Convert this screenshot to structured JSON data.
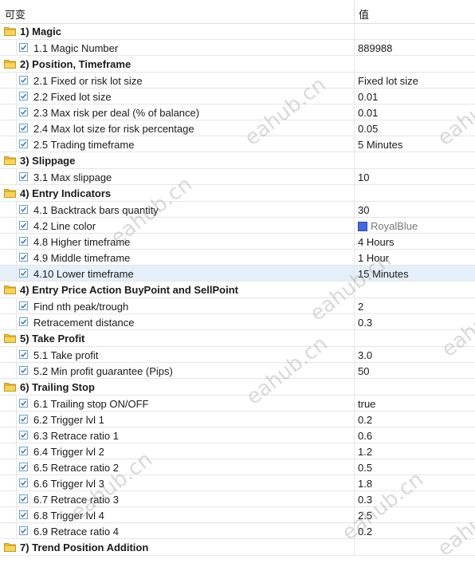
{
  "header": {
    "col_variable": "可变",
    "col_value": "值"
  },
  "rows": [
    {
      "type": "group",
      "label": "1) Magic"
    },
    {
      "type": "item",
      "label": "1.1 Magic Number",
      "value": "889988"
    },
    {
      "type": "group",
      "label": "2) Position, Timeframe"
    },
    {
      "type": "item",
      "label": "2.1 Fixed or risk lot size",
      "value": "Fixed lot size"
    },
    {
      "type": "item",
      "label": "2.2 Fixed lot size",
      "value": "0.01"
    },
    {
      "type": "item",
      "label": "2.3 Max risk per deal (% of balance)",
      "value": "0.01"
    },
    {
      "type": "item",
      "label": "2.4 Max lot size for risk percentage",
      "value": "0.05"
    },
    {
      "type": "item",
      "label": "2.5 Trading timeframe",
      "value": "5 Minutes"
    },
    {
      "type": "group",
      "label": "3) Slippage"
    },
    {
      "type": "item",
      "label": "3.1 Max slippage",
      "value": "10"
    },
    {
      "type": "group",
      "label": "4) Entry Indicators"
    },
    {
      "type": "item",
      "label": "4.1 Backtrack bars quantity",
      "value": "30"
    },
    {
      "type": "item",
      "label": "4.2 Line color",
      "value": "RoyalBlue",
      "color": "#4169E1"
    },
    {
      "type": "item",
      "label": "4.8 Higher timeframe",
      "value": "4 Hours"
    },
    {
      "type": "item",
      "label": "4.9 Middle timeframe",
      "value": "1 Hour"
    },
    {
      "type": "item",
      "label": "4.10 Lower timeframe",
      "value": "15 Minutes",
      "selected": true
    },
    {
      "type": "group",
      "label": "4) Entry Price Action BuyPoint and SellPoint"
    },
    {
      "type": "item",
      "label": "Find nth peak/trough",
      "value": "2"
    },
    {
      "type": "item",
      "label": "Retracement distance",
      "value": "0.3"
    },
    {
      "type": "group",
      "label": "5) Take Profit"
    },
    {
      "type": "item",
      "label": "5.1 Take profit",
      "value": "3.0"
    },
    {
      "type": "item",
      "label": "5.2 Min profit guarantee (Pips)",
      "value": "50"
    },
    {
      "type": "group",
      "label": "6) Trailing Stop"
    },
    {
      "type": "item",
      "label": "6.1 Trailing stop ON/OFF",
      "value": "true"
    },
    {
      "type": "item",
      "label": "6.2 Trigger lvl 1",
      "value": "0.2"
    },
    {
      "type": "item",
      "label": "6.3 Retrace ratio 1",
      "value": "0.6"
    },
    {
      "type": "item",
      "label": "6.4 Trigger lvl 2",
      "value": "1.2"
    },
    {
      "type": "item",
      "label": "6.5 Retrace ratio 2",
      "value": "0.5"
    },
    {
      "type": "item",
      "label": "6.6 Trigger lvl 3",
      "value": "1.8"
    },
    {
      "type": "item",
      "label": "6.7 Retrace ratio 3",
      "value": "0.3"
    },
    {
      "type": "item",
      "label": "6.8 Trigger lvl 4",
      "value": "2.5"
    },
    {
      "type": "item",
      "label": "6.9 Retrace ratio 4",
      "value": "0.2"
    },
    {
      "type": "group",
      "label": "7) Trend Position Addition"
    }
  ],
  "watermark": "eahub.cn"
}
